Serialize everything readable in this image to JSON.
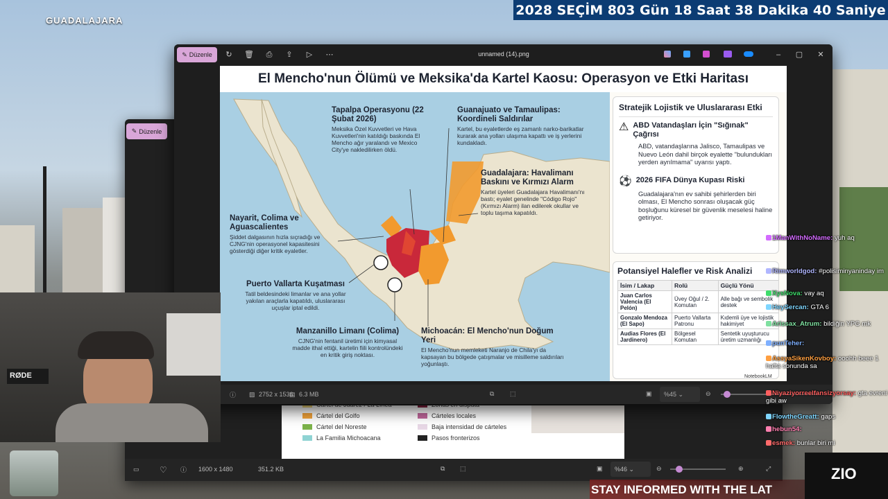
{
  "overlay": {
    "city": "GUADALAJARA",
    "countdown": {
      "year": "2028",
      "label": "SEÇİM",
      "days": "803 Gün",
      "hours": "18 Saat",
      "minutes": "38 Dakika",
      "seconds": "40 Saniye"
    },
    "ticker": "STAY INFORMED WITH THE LAT",
    "logo": "ZIO"
  },
  "colors": {
    "edit_button": "#d9a6d8",
    "countdown_bg": "#0c3c73",
    "orange_region": "#f29a2e",
    "red_region": "#c9283a",
    "water": "#a9cfe3"
  },
  "front_window": {
    "edit_label": "Düzenle",
    "title": "unnamed (14).png",
    "toolbar_icons": [
      "rotate-icon",
      "delete-icon",
      "print-icon",
      "share-icon",
      "slideshow-icon",
      "more-icon"
    ],
    "status": {
      "dimensions": "2752 x 1536",
      "size": "6.3 MB",
      "zoom": "%45"
    }
  },
  "back_window": {
    "edit_label": "Düzenle",
    "status": {
      "dimensions": "1600 x 1480",
      "size": "351.2 KB",
      "zoom": "%46"
    },
    "legend": [
      {
        "label": "Cártel de Juárez / La Línea",
        "color": "#f0d779"
      },
      {
        "label": "Cártel del Golfo",
        "color": "#f2a33a"
      },
      {
        "label": "Cártel del Noreste",
        "color": "#7cb34a"
      },
      {
        "label": "La Familia Michoacana",
        "color": "#8fd3d3"
      },
      {
        "label": "Zonas en disputa",
        "color": "#8a2241"
      },
      {
        "label": "Cárteles locales",
        "color": "#c0679b"
      },
      {
        "label": "Baja intensidad de cárteles",
        "color": "#e8d8e6"
      },
      {
        "label": "Pasos fronterizos",
        "color": "#222222"
      }
    ]
  },
  "infographic": {
    "title": "El Mencho'nun Ölümü ve Meksika'da Kartel Kaosu: Operasyon ve Etki Haritası",
    "annotations": {
      "tapalpa": {
        "title": "Tapalpa Operasyonu (22 Şubat 2026)",
        "body": "Meksika Özel Kuvvetleri ve Hava Kuvvetleri'nin katıldığı baskında El Mencho ağır yaralandı ve Mexico City'ye nakledilirken öldü."
      },
      "guanajuato": {
        "title": "Guanajuato ve Tamaulipas: Koordineli Saldırılar",
        "body": "Kartel, bu eyaletlerde eş zamanlı narko-barikatlar kurarak ana yolları ulaşıma kapattı ve iş yerlerini kundakladı."
      },
      "guadalajara": {
        "title": "Guadalajara: Havalimanı Baskını ve Kırmızı Alarm",
        "body": "Kartel üyeleri Guadalajara Havalimanı'nı bastı; eyalet genelinde \"Código Rojo\" (Kırmızı Alarm) ilan edilerek okullar ve toplu taşıma kapatıldı."
      },
      "nayarit": {
        "title": "Nayarit, Colima ve Aguascalientes",
        "body": "Şiddet dalgasının hızla sıçradığı ve CJNG'nin operasyonel kapasitesini gösterdiği diğer kritik eyaletler."
      },
      "puerto": {
        "title": "Puerto Vallarta Kuşatması",
        "body": "Tatil beldesindeki limanlar ve ana yollar yakılan araçlarla kapatıldı, uluslararası uçuşlar iptal edildi."
      },
      "manzanillo": {
        "title": "Manzanillo Limanı (Colima)",
        "body": "CJNG'nin fentanil üretimi için kimyasal madde ithal ettiği, kartelin fiili kontrolündeki en kritik giriş noktası."
      },
      "michoacan": {
        "title": "Michoacán: El Mencho'nun Doğum Yeri",
        "body": "El Mencho'nun memleketi Naranjo de Chila'yı da kapsayan bu bölgede çatışmalar ve misilleme saldırıları yoğunlaştı."
      }
    },
    "logistics": {
      "heading": "Stratejik Lojistik ve Uluslararası Etki",
      "item1_title": "ABD Vatandaşları İçin \"Sığınak\" Çağrısı",
      "item1_body": "ABD, vatandaşlarına Jalisco, Tamaulipas ve Nuevo León dahil birçok eyalette \"bulundukları yerden ayrılmama\" uyarısı yaptı.",
      "item2_title": "2026 FIFA Dünya Kupası Riski",
      "item2_body": "Guadalajara'nın ev sahibi şehirlerden biri olması, El Mencho sonrası oluşacak güç boşluğunu küresel bir güvenlik meselesi haline getiriyor."
    },
    "successors": {
      "heading": "Potansiyel Halefler ve Risk Analizi",
      "columns": [
        "İsim / Lakap",
        "Rolü",
        "Güçlü Yönü"
      ],
      "rows": [
        [
          "Juan Carlos Valencia (El Pelón)",
          "Üvey Oğul / 2. Komutan",
          "Alle bağı ve sembolik destek"
        ],
        [
          "Gonzalo Mendoza (El Sapo)",
          "Puerto Vallarta Patronu",
          "Kıdemli üye ve lojistik hakimiyet"
        ],
        [
          "Audias Flores (El Jardinero)",
          "Bölgesel Komutan",
          "Sentetik uyuşturucu üretim uzmanlığı"
        ]
      ]
    },
    "watermark": "NotebookLM"
  },
  "chat": [
    {
      "user": "1ManWithNoName:",
      "text": "yuh aq",
      "color": "#d36bff"
    },
    {
      "user": "Rimworldgod:",
      "text": "#polisiminyaninday im",
      "color": "#b0b6ff"
    },
    {
      "user": "XysNova:",
      "text": "vay aq",
      "color": "#3fdc6b"
    },
    {
      "user": "HeySercan:",
      "text": "GTA 6",
      "color": "#7fd6ff"
    },
    {
      "user": "Arissax_Atrum:",
      "text": "bildiğin YPG mk",
      "color": "#7fe0a0"
    },
    {
      "user": "punTeher:",
      "text": "",
      "color": "#7fb0ff"
    },
    {
      "user": "AssyaSikenKovboy:",
      "text": "ooohh beee 1 hafta sonunda sa",
      "color": "#ff9f40"
    },
    {
      "user": "Niyaziyorreelfansizyorsay:",
      "text": "gta evreni gibi aw",
      "color": "#ff5f5f"
    },
    {
      "user": "FlowtheGreatt:",
      "text": "gaps",
      "color": "#7fd6ff"
    },
    {
      "user": "hebun54:",
      "text": "",
      "color": "#ff7fb0"
    },
    {
      "user": "esmek:",
      "text": "bunlar biri mi",
      "color": "#ff6b6b"
    }
  ]
}
